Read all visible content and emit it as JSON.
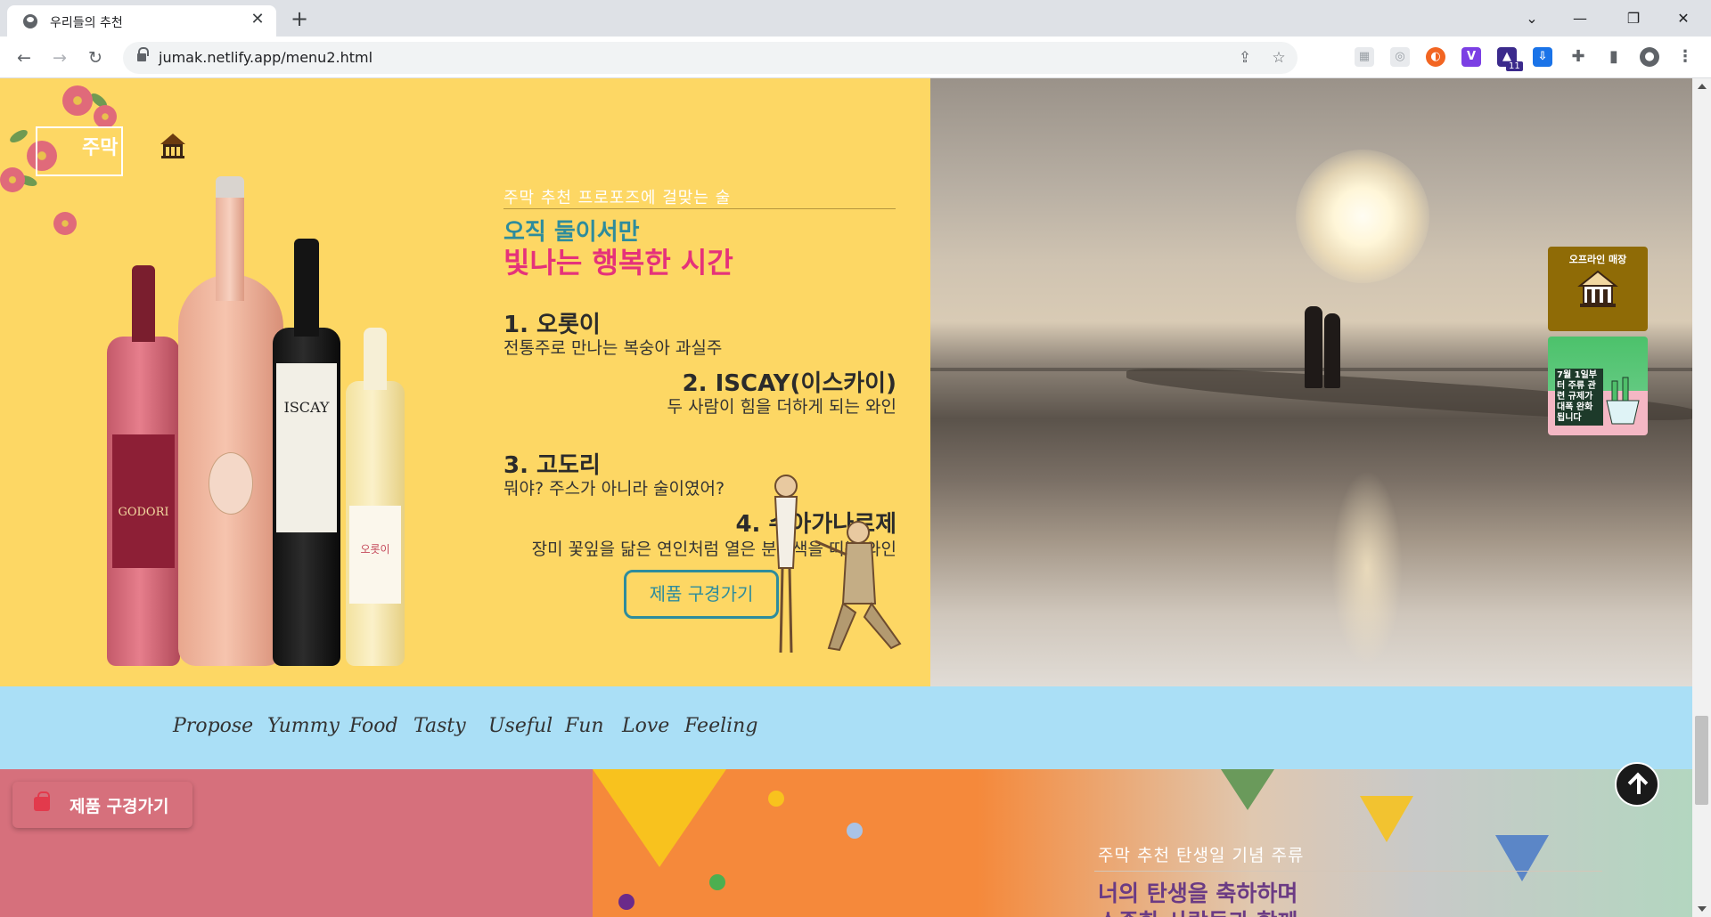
{
  "browser": {
    "tab_title": "우리들의 추천",
    "url": "jumak.netlify.app/menu2.html",
    "colors": {
      "tabbar": "#dee1e6",
      "omnibox": "#f1f3f4"
    },
    "icons": [
      "back-icon",
      "forward-icon",
      "reload-icon",
      "lock-icon",
      "share-icon",
      "star-icon",
      "extensions-icon",
      "sidebar-icon",
      "profile-icon",
      "menu-icon"
    ],
    "extension_badge": "11"
  },
  "site": {
    "logo_text": "주막",
    "logo_icon": "thatched-house-icon"
  },
  "hero": {
    "subtitle": "주막 추천 프로포즈에 걸맞는 술",
    "headline_1": "오직 둘이서만",
    "headline_2": "빛나는 행복한 시간",
    "items": [
      {
        "title": "1. 오롯이",
        "desc": "전통주로 만나는 복숭아 과실주"
      },
      {
        "title": "2. ISCAY(이스카이)",
        "desc": "두 사람이 힘을 더하게 되는 와인"
      },
      {
        "title": "3. 고도리",
        "desc": "뭐야? 주스가 아니라 술이였어?"
      },
      {
        "title": "4. 수아가나로제",
        "desc": "장미 꽃잎을 닮은 연인처럼 열은 분홍색을 띠는 와인"
      }
    ],
    "cta_label": "제품 구경가기",
    "bottle_labels": [
      "GODORI",
      "ISCAY",
      "오롯이"
    ],
    "colors": {
      "background": "#fdd764",
      "headline_1": "#2e8c9c",
      "headline_2": "#e5327a"
    }
  },
  "side_banners": {
    "offline_title": "오프라인 매장",
    "promo_text": "7월 1일부터 주류 관련 규제가 대폭 완화 됩니다"
  },
  "nav": {
    "items": [
      "Propose",
      "Yummy",
      "Food",
      "Tasty",
      "Useful",
      "Fun",
      "Love",
      "Feeling"
    ],
    "background": "#aadff6"
  },
  "section3": {
    "subtitle": "주막 추천 탄생일 기념 주류",
    "headline_1": "너의 탄생을 축하하며",
    "headline_2": "소중한 사람들과 함께"
  },
  "floating_cta": {
    "label": "제품 구경가기",
    "icon": "shopping-bag-icon"
  },
  "scroll_top_icon": "arrow-up-icon"
}
